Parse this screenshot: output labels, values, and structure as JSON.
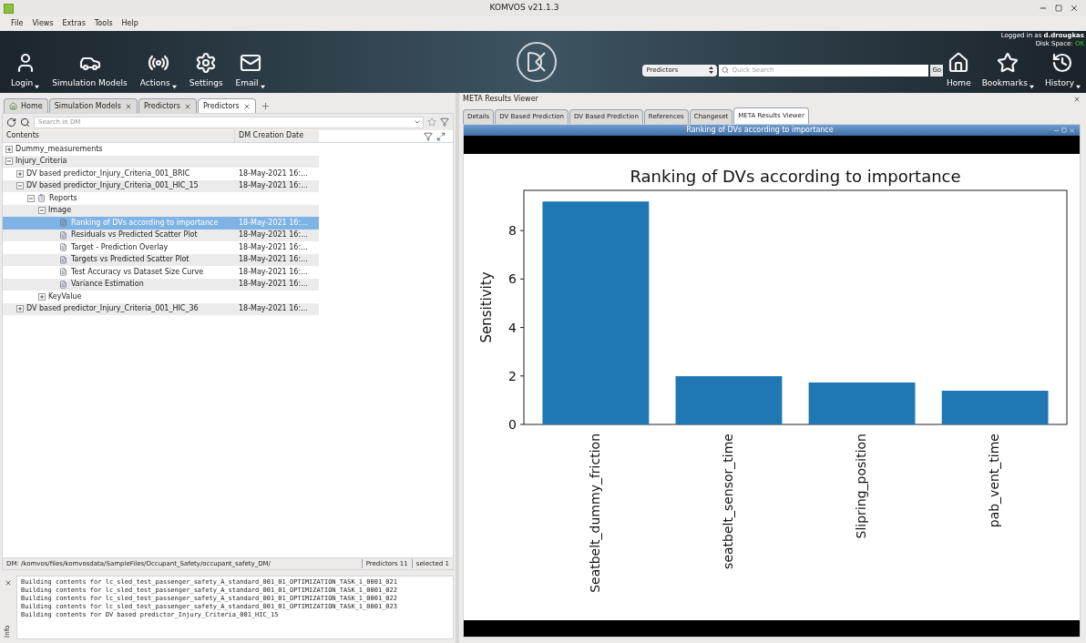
{
  "window": {
    "title": "KOMVOS v21.1.3"
  },
  "menu": [
    "File",
    "Views",
    "Extras",
    "Tools",
    "Help"
  ],
  "toolbar": [
    {
      "label": "Login",
      "kind": "login",
      "dropdown": true
    },
    {
      "label": "Simulation Models",
      "kind": "car",
      "dropdown": false
    },
    {
      "label": "Actions",
      "kind": "actions",
      "dropdown": true
    },
    {
      "label": "Settings",
      "kind": "settings",
      "dropdown": false
    },
    {
      "label": "Email",
      "kind": "email",
      "dropdown": true
    }
  ],
  "user": {
    "prefix": "Logged in as",
    "name": "d.drougkas",
    "disk_label": "Disk Space:",
    "disk_value": "OK"
  },
  "quick_search": {
    "scope": "Predictors",
    "placeholder": "Quick Search",
    "button": "Go"
  },
  "nav": [
    {
      "label": "Home",
      "kind": "home",
      "dropdown": false
    },
    {
      "label": "Bookmarks",
      "kind": "bookmarks",
      "dropdown": true
    },
    {
      "label": "History",
      "kind": "history",
      "dropdown": true
    }
  ],
  "left_tabs": [
    {
      "label": "Home",
      "closable": false,
      "selected": false
    },
    {
      "label": "Simulation Models",
      "closable": true,
      "selected": false
    },
    {
      "label": "Predictors",
      "closable": true,
      "selected": false
    },
    {
      "label": "Predictors",
      "closable": true,
      "selected": true
    }
  ],
  "dm_search": {
    "placeholder": "Search in DM"
  },
  "tree": {
    "columns": [
      "Contents",
      "DM Creation Date"
    ],
    "items": [
      {
        "label": "Dummy_measurements",
        "expanded": false,
        "selected": false
      },
      {
        "label": "Injury_Criteria",
        "expanded": true,
        "selected": false,
        "children": [
          {
            "label": "DV based predictor_Injury_Criteria_001_BRIC",
            "expanded": false,
            "selected": false,
            "date": "18-May-2021 16:..."
          },
          {
            "label": "DV based predictor_Injury_Criteria_001_HIC_15",
            "expanded": true,
            "selected": false,
            "date": "18-May-2021 16:...",
            "children": [
              {
                "label": "Reports",
                "kind": "report",
                "expanded": true,
                "selected": false,
                "children": [
                  {
                    "label": "Image",
                    "expanded": true,
                    "selected": false,
                    "children": [
                      {
                        "label": "Ranking of DVs according to importance",
                        "kind": "document",
                        "selected": true,
                        "date": "18-May-2021 16:..."
                      },
                      {
                        "label": "Residuals vs Predicted Scatter Plot",
                        "kind": "document",
                        "selected": false,
                        "date": "18-May-2021 16:..."
                      },
                      {
                        "label": "Target - Prediction Overlay",
                        "kind": "document",
                        "selected": false,
                        "date": "18-May-2021 16:..."
                      },
                      {
                        "label": "Targets vs Predicted Scatter Plot",
                        "kind": "document",
                        "selected": false,
                        "date": "18-May-2021 16:..."
                      },
                      {
                        "label": "Test Accuracy vs Dataset Size Curve",
                        "kind": "document",
                        "selected": false,
                        "date": "18-May-2021 16:..."
                      },
                      {
                        "label": "Variance Estimation",
                        "kind": "document",
                        "selected": false,
                        "date": "18-May-2021 16:..."
                      }
                    ]
                  },
                  {
                    "label": "KeyValue",
                    "expanded": false,
                    "selected": false
                  }
                ]
              }
            ]
          },
          {
            "label": "DV based predictor_Injury_Criteria_001_HIC_36",
            "expanded": false,
            "selected": false,
            "date": "18-May-2021 16:..."
          }
        ]
      }
    ]
  },
  "status_bar": {
    "path": "DM: /komvos/files/komvosdata/SampleFiles/Occupant_Safety/occupant_safety_DM/",
    "count": "Predictors 11",
    "selection": "selected 1"
  },
  "log": {
    "label": "Info",
    "lines": [
      "Building contents for lc_sled_test_passenger_safety_A_standard_001_01_OPTIMIZATION_TASK_1_0001_021",
      "Building contents for lc_sled_test_passenger_safety_A_standard_001_01_OPTIMIZATION_TASK_1_0001_022",
      "Building contents for lc_sled_test_passenger_safety_A_standard_001_01_OPTIMIZATION_TASK_1_0001_022",
      "Building contents for lc_sled_test_passenger_safety_A_standard_001_01_OPTIMIZATION_TASK_1_0001_023",
      "Building contents for DV based predictor_Injury_Criteria_001_HIC_15"
    ]
  },
  "viewer": {
    "title": "META Results Viewer",
    "tabs": [
      {
        "label": "Details",
        "selected": false
      },
      {
        "label": "DV Based Prediction",
        "selected": false
      },
      {
        "label": "DV Based Prediction",
        "selected": false
      },
      {
        "label": "References",
        "selected": false
      },
      {
        "label": "Changeset",
        "selected": false
      },
      {
        "label": "META Results Viewer",
        "selected": true
      }
    ],
    "window_title": "Ranking of DVs according to importance",
    "chart_data": {
      "type": "bar",
      "title": "Ranking of DVs according to importance",
      "ylabel": "Sensitivity",
      "categories": [
        "Seatbelt_dummy_friction",
        "seatbelt_sensor_time",
        "Slipring_position",
        "pab_vent_time"
      ],
      "values": [
        9.2,
        1.99,
        1.73,
        1.39
      ],
      "ylim": [
        0,
        9.66
      ],
      "yticks": [
        0,
        2,
        4,
        6,
        8
      ]
    }
  }
}
